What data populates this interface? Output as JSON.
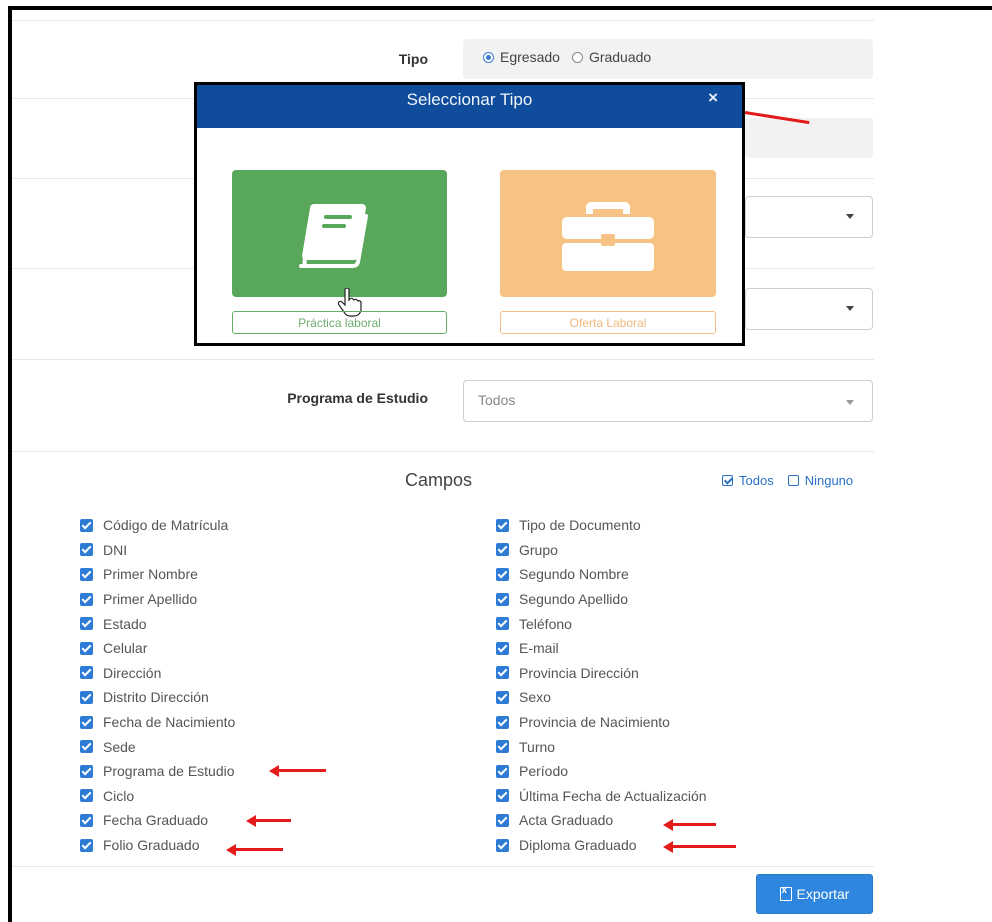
{
  "form": {
    "tipo_label": "Tipo",
    "tipo_options": [
      "Egresado",
      "Graduado"
    ],
    "tipo_selected": "Egresado",
    "programa_label": "Programa de Estudio",
    "programa_value": "Todos"
  },
  "modal": {
    "title": "Seleccionar Tipo",
    "close_glyph": "×",
    "options": [
      "Práctica laboral",
      "Oferta Laboral"
    ]
  },
  "campos": {
    "title": "Campos",
    "select_all": "Todos",
    "select_none": "Ninguno",
    "left": [
      "Código de Matrícula",
      "DNI",
      "Primer Nombre",
      "Primer Apellido",
      "Estado",
      "Celular",
      "Dirección",
      "Distrito Dirección",
      "Fecha de Nacimiento",
      "Sede",
      "Programa de Estudio",
      "Ciclo",
      "Fecha Graduado",
      "Folio Graduado"
    ],
    "right": [
      "Tipo de Documento",
      "Grupo",
      "Segundo Nombre",
      "Segundo Apellido",
      "Teléfono",
      "E-mail",
      "Provincia Dirección",
      "Sexo",
      "Provincia de Nacimiento",
      "Turno",
      "Período",
      "Última Fecha de Actualización",
      "Acta Graduado",
      "Diploma Graduado"
    ]
  },
  "export_button": "Exportar",
  "colors": {
    "modal_header": "#0f4c9c",
    "tile_green": "#58a75a",
    "tile_orange": "#f7c384",
    "checkbox_blue": "#2e7bd6",
    "annotation_red": "#e41b1b"
  }
}
